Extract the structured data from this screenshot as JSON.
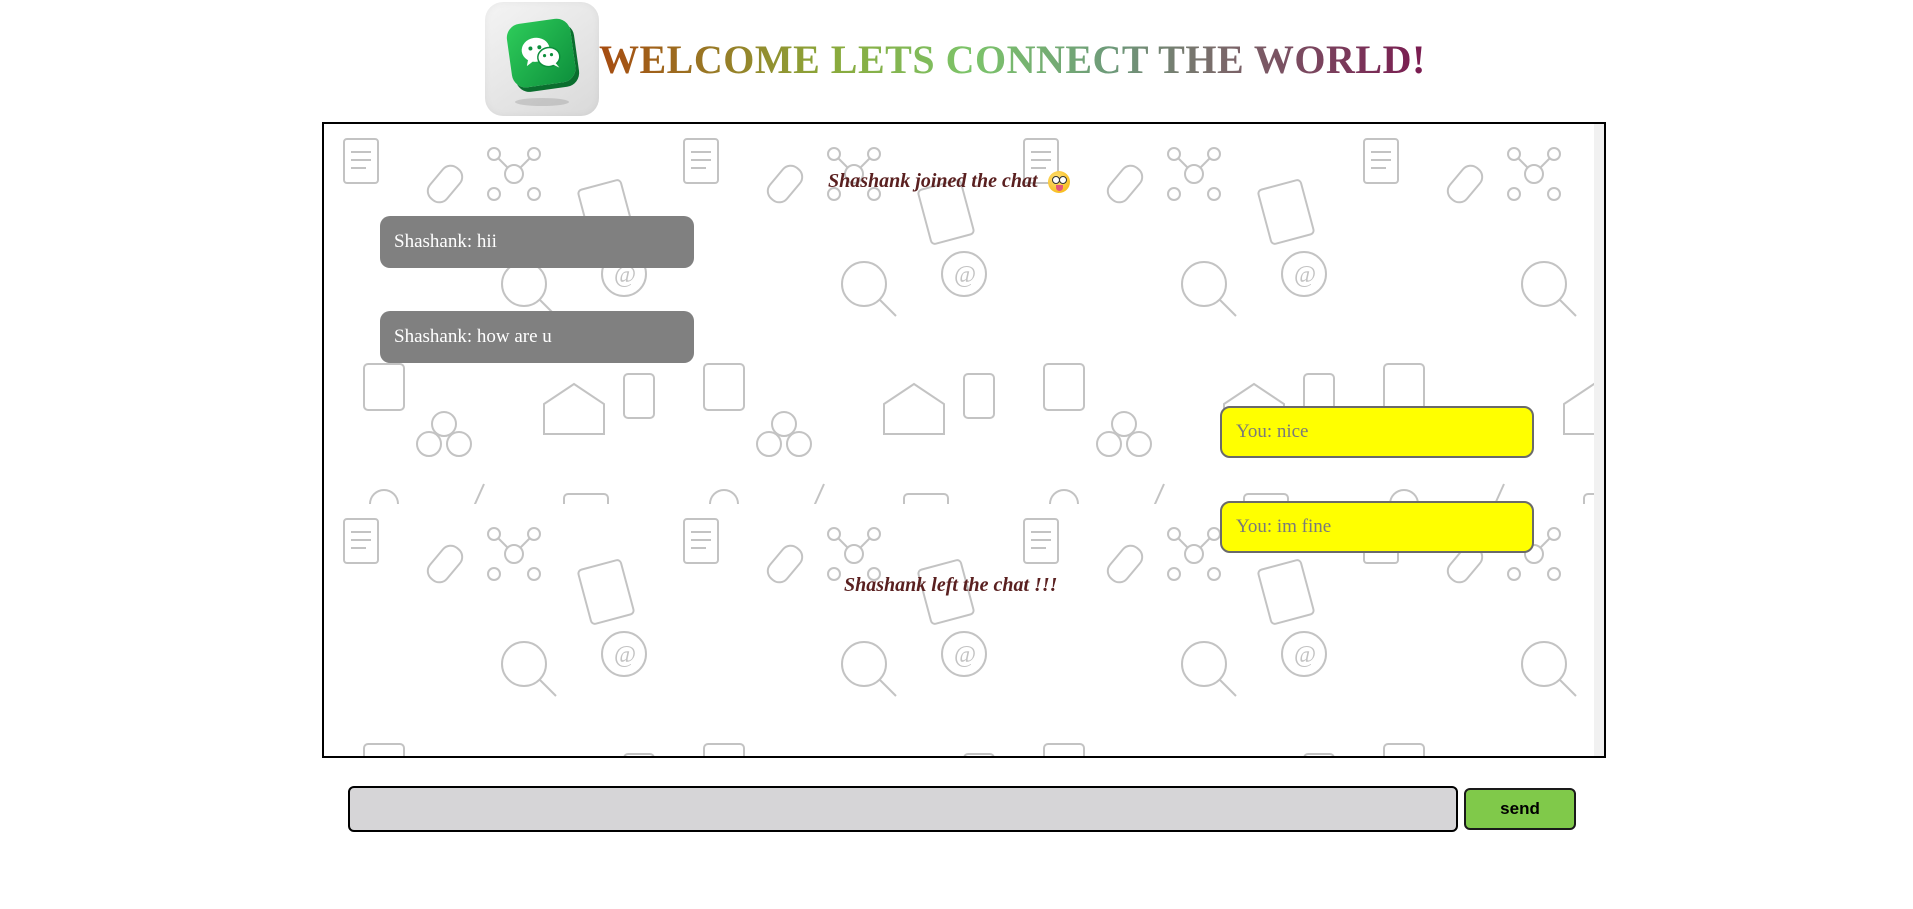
{
  "header": {
    "logo_icon": "wechat-logo-icon",
    "title": "WELCOME LETS CONNECT THE WORLD!"
  },
  "chat": {
    "background": "doodle-pattern",
    "notices": {
      "joined": "Shashank joined the chat",
      "joined_emoji": "crazy-face-emoji",
      "left": "Shashank left the chat !!!"
    },
    "incoming": [
      {
        "text": "Shashank: hii"
      },
      {
        "text": "Shashank: how are u"
      }
    ],
    "outgoing": [
      {
        "text": "You: nice"
      },
      {
        "text": "You: im fine"
      }
    ],
    "colors": {
      "incoming_bg": "#808080",
      "outgoing_bg": "#ffff00",
      "notice_text": "#5a2020"
    }
  },
  "composer": {
    "input_value": "",
    "placeholder": "",
    "send_label": "send",
    "send_color": "#80c94a"
  }
}
